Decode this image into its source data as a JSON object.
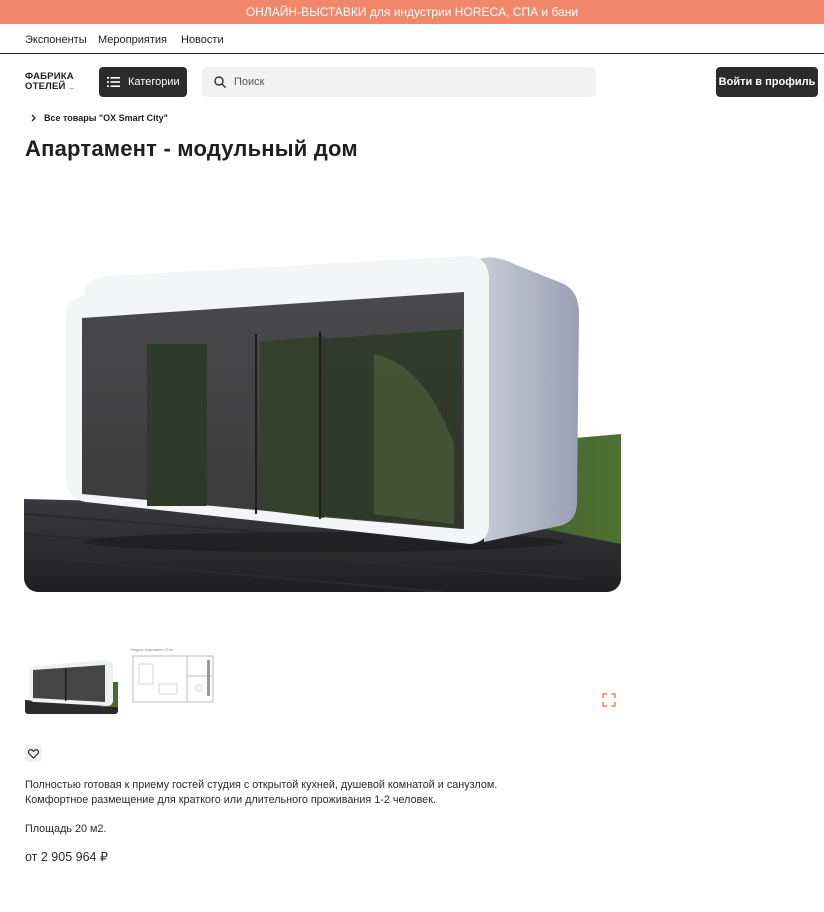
{
  "banner": {
    "text": "ОНЛАЙН-ВЫСТАВКИ для индустрии HORECA, СПА и бани"
  },
  "topnav": {
    "items": [
      "Экспоненты",
      "Мероприятия",
      "Новости"
    ]
  },
  "header": {
    "logo_line1": "ФАБРИКА",
    "logo_line2": "ОТЕЛЕЙ",
    "categories_label": "Категории",
    "search_placeholder": "Поиск",
    "login_label": "Войти в профиль"
  },
  "breadcrumb": {
    "label": "Все товары \"OX Smart City\""
  },
  "product": {
    "title": "Апартамент - модульный дом",
    "description_line1": "Полностью готовая к приему гостей студия с открытой кухней, душевой комнатой и санузлом.",
    "description_line2": "Комфортное размещение для краткого или длительного проживания 1-2 человек.",
    "area": "Площадь 20 м2.",
    "price": "от 2 905 964 ₽"
  },
  "colors": {
    "accent": "#f0876b",
    "dark_button": "#2b2b2b"
  },
  "icons": [
    "hamburger-icon",
    "search-icon",
    "chevron-right-icon",
    "expand-icon",
    "heart-icon"
  ]
}
